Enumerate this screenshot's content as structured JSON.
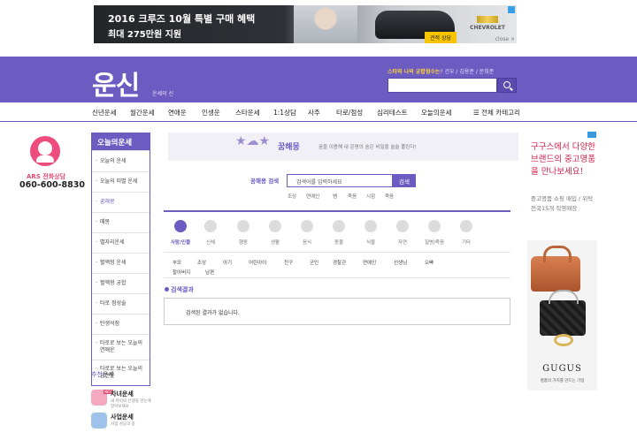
{
  "top_ad": {
    "line1": "2016 크루즈 10월 특별 구매 혜택",
    "line2": "최대 275만원 지원",
    "cta": "견적 상담",
    "brand": "CHEVROLET",
    "close": "close ×"
  },
  "header": {
    "logo": "운신",
    "logo_sub": "운세의 신",
    "hot_prefix": "스타와 나의 궁합점수는",
    "hot_rest": "? 건우 / 김용준 / 문희준",
    "search_value": ""
  },
  "nav": {
    "items": [
      "신년운세",
      "월간운세",
      "연애운",
      "인생운",
      "스타운세",
      "1:1상담",
      "사주",
      "타로/점성",
      "심리테스트",
      "오늘의운세",
      "☰ 전체 카테고리"
    ]
  },
  "phone": {
    "label": "ARS 전화상담",
    "number": "060-600-8830"
  },
  "sidebar": {
    "title": "오늘의운세",
    "items": [
      "오늘의 운세",
      "오늘의 띠별 운세",
      "꿈해몽",
      "매몽",
      "별자리운세",
      "혈액형 운세",
      "혈액형 궁합",
      "타로 점성술",
      "탄생석점",
      "타로로 보는 오늘의 연애운",
      "타로로 보는 오늘의 금전운"
    ],
    "active_index": 2,
    "rec_title_accent": "추천",
    "rec_title_rest": "운세",
    "recommended": [
      {
        "name": "자녀운세",
        "desc": "내 아이의 인생을 한눈에 알아보세요",
        "badge": "NEW"
      },
      {
        "name": "사업운세",
        "desc": "사업 성공의 길",
        "badge": ""
      }
    ]
  },
  "dream": {
    "banner_title": "꿈해몽",
    "banner_desc": "꿈을 이용해 내 운명의 숨은 비밀을 술술 풀린다!",
    "search_label": "꿈해몽 검색",
    "search_placeholder": "검색어를 입력하세요",
    "search_button": "검색",
    "keywords": [
      "조상",
      "연예인",
      "뱀",
      "죽음",
      "시험",
      "죽음"
    ]
  },
  "categories": [
    {
      "label": "사람/인물",
      "active": true
    },
    {
      "label": "신체",
      "active": false
    },
    {
      "label": "행동",
      "active": false
    },
    {
      "label": "생활",
      "active": false
    },
    {
      "label": "음식",
      "active": false
    },
    {
      "label": "동물",
      "active": false
    },
    {
      "label": "식물",
      "active": false
    },
    {
      "label": "자연",
      "active": false
    },
    {
      "label": "질병/죽음",
      "active": false
    },
    {
      "label": "기타",
      "active": false
    }
  ],
  "sub_keywords": [
    "부모",
    "조상",
    "아기",
    "어린아이",
    "친구",
    "군인",
    "경찰관",
    "연예인",
    "선생님",
    "오빠",
    "할아버지",
    "남편"
  ],
  "result": {
    "title": "검색결과",
    "message": "검색된 결과가 없습니다."
  },
  "right_ad": {
    "headline": "구구스에서 다양한 브랜드의 중고명품을 만나보세요!",
    "small": "중고명품 쇼핑 매입 / 위탁 전국15개 직영매장",
    "brand": "GUGUS",
    "brand_sub": "명품의 가치를 만드는 기업"
  },
  "colors": {
    "brand_purple": "#6c5bc0",
    "accent_pink": "#e2456b",
    "ad_red": "#d2204b"
  }
}
